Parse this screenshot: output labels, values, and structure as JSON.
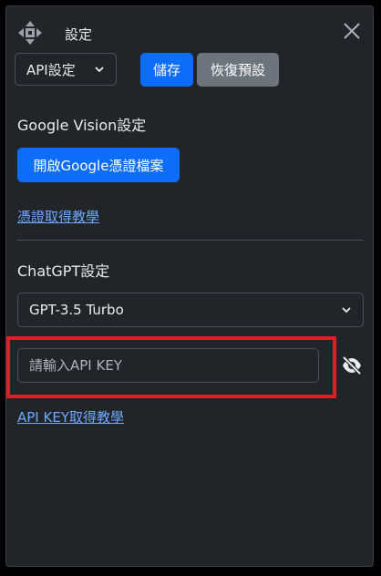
{
  "header": {
    "title": "設定",
    "move_icon": "move-arrows-icon",
    "close_icon": "close-icon"
  },
  "toolbar": {
    "api_select_value": "API設定",
    "save_label": "儲存",
    "reset_label": "恢復預設"
  },
  "google_vision": {
    "heading": "Google Vision設定",
    "open_button_label": "開啟Google憑證檔案",
    "tutorial_link": "憑證取得教學"
  },
  "chatgpt": {
    "heading": "ChatGPT設定",
    "model_value": "GPT-3.5 Turbo",
    "api_key_placeholder": "請輸入API KEY",
    "api_key_value": "",
    "toggle_visibility_icon": "eye-slash-icon",
    "api_key_link": "API KEY取得教學"
  },
  "colors": {
    "primary": "#0d6efd",
    "secondary": "#6c757d",
    "link": "#6ea8fe",
    "highlight": "#e11d27",
    "panel_bg": "#212529"
  }
}
